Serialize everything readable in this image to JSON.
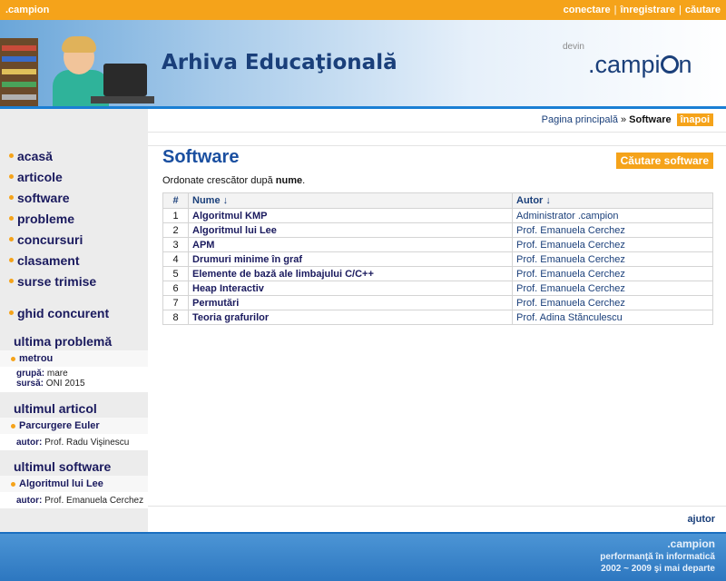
{
  "topbar": {
    "site": ".campion",
    "login": "conectare",
    "register": "înregistrare",
    "search": "căutare"
  },
  "banner": {
    "title": "Arhiva Educaţională",
    "brand_small": "devin",
    "brand_text": ".campi",
    "brand_end": "n"
  },
  "sidebar": {
    "nav": [
      "acasă",
      "articole",
      "software",
      "probleme",
      "concursuri",
      "clasament",
      "surse trimise"
    ],
    "guide": "ghid concurent",
    "last_problem": {
      "heading": "ultima problemă",
      "title": "metrou",
      "group_label": "grupă:",
      "group_value": "mare",
      "source_label": "sursă:",
      "source_value": "ONI 2015"
    },
    "last_article": {
      "heading": "ultimul articol",
      "title": "Parcurgere Euler",
      "author_label": "autor:",
      "author_value": "Prof. Radu Vişinescu"
    },
    "last_software": {
      "heading": "ultimul software",
      "title": "Algoritmul lui Lee",
      "author_label": "autor:",
      "author_value": "Prof. Emanuela Cerchez"
    }
  },
  "breadcrumb": {
    "home": "Pagina principală",
    "sep": "»",
    "current": "Software",
    "back": "înapoi"
  },
  "main": {
    "title": "Software",
    "search_button": "Căutare software",
    "order_prefix": "Ordonate crescător după",
    "order_field": "nume",
    "order_suffix": "."
  },
  "table": {
    "headers": {
      "num": "#",
      "name": "Nume ↓",
      "author": "Autor ↓"
    },
    "rows": [
      {
        "num": "1",
        "name": "Algoritmul KMP",
        "author": "Administrator .campion"
      },
      {
        "num": "2",
        "name": "Algoritmul lui Lee",
        "author": "Prof. Emanuela Cerchez"
      },
      {
        "num": "3",
        "name": "APM",
        "author": "Prof. Emanuela Cerchez"
      },
      {
        "num": "4",
        "name": "Drumuri minime în graf",
        "author": "Prof. Emanuela Cerchez"
      },
      {
        "num": "5",
        "name": "Elemente de bază ale limbajului C/C++",
        "author": "Prof. Emanuela Cerchez"
      },
      {
        "num": "6",
        "name": "Heap Interactiv",
        "author": "Prof. Emanuela Cerchez"
      },
      {
        "num": "7",
        "name": "Permutări",
        "author": "Prof. Emanuela Cerchez"
      },
      {
        "num": "8",
        "name": "Teoria grafurilor",
        "author": "Prof. Adina Stănculescu"
      }
    ]
  },
  "help": "ajutor",
  "footer": {
    "brand": ".campion",
    "tagline": "performanţă în informatică",
    "years": "2002 ~ 2009 şi mai departe"
  },
  "colors": {
    "accent": "#f5a31a",
    "brand_blue": "#1a3f7a",
    "link_blue": "#1a4fa0",
    "footer_blue": "#2d77c0"
  }
}
